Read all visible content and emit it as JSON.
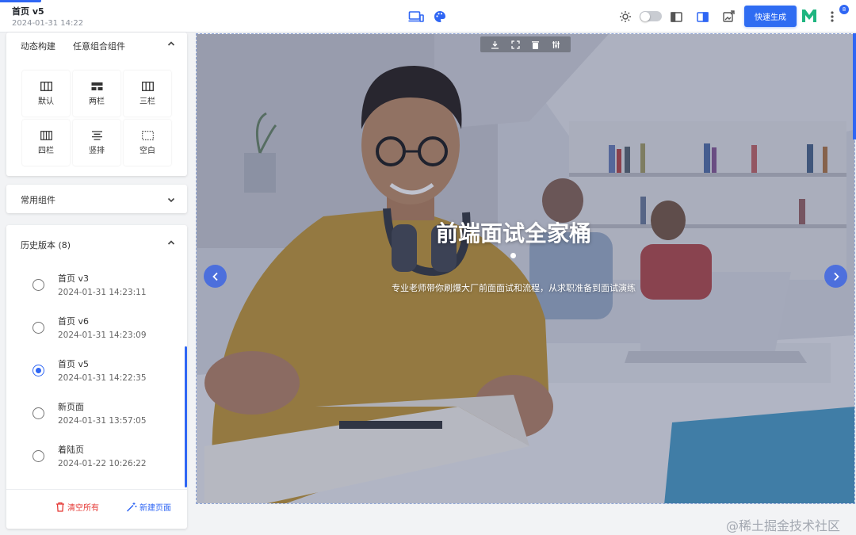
{
  "header": {
    "page_title": "首页 v5",
    "page_time": "2024-01-31 14:22",
    "quick_generate_label": "快速生成",
    "notification_count": "8"
  },
  "component_panel": {
    "tabs": [
      "动态构建",
      "任意组合组件"
    ],
    "layouts": [
      {
        "label": "默认",
        "icon": "three-column-icon"
      },
      {
        "label": "两栏",
        "icon": "two-column-icon"
      },
      {
        "label": "三栏",
        "icon": "three-column-icon"
      },
      {
        "label": "四栏",
        "icon": "four-column-icon"
      },
      {
        "label": "竖排",
        "icon": "vertical-align-icon"
      },
      {
        "label": "空白",
        "icon": "blank-dotted-icon"
      }
    ]
  },
  "common_components": {
    "title": "常用组件"
  },
  "history": {
    "title": "历史版本 (8)",
    "items": [
      {
        "name": "首页 v3",
        "time": "2024-01-31 14:23:11",
        "selected": false
      },
      {
        "name": "首页 v6",
        "time": "2024-01-31 14:23:09",
        "selected": false
      },
      {
        "name": "首页 v5",
        "time": "2024-01-31 14:22:35",
        "selected": true
      },
      {
        "name": "新页面",
        "time": "2024-01-31 13:57:05",
        "selected": false
      },
      {
        "name": "着陆页",
        "time": "2024-01-22 10:26:22",
        "selected": false
      }
    ],
    "clear_label": "清空所有",
    "new_label": "新建页面"
  },
  "hero": {
    "title": "前端面试全家桶",
    "subtitle": "专业老师带你刷爆大厂前面面试和流程，从求职准备到面试演练"
  },
  "watermark": "@稀土掘金技术社区",
  "colors": {
    "accent": "#2f66f4",
    "danger": "#e53935",
    "logo_green": "#1fb580"
  }
}
